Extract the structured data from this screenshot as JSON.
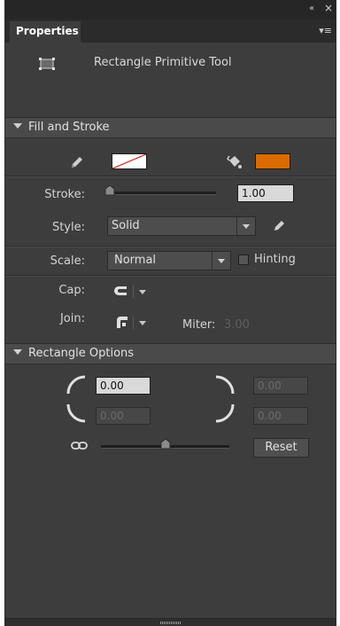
{
  "panel": {
    "collapse_icon": "«",
    "close_icon": "×",
    "menu_icon": "≡"
  },
  "tab": {
    "label": "Properties"
  },
  "tool": {
    "name": "Rectangle Primitive Tool",
    "icon": "rectangle-primitive-icon"
  },
  "fill_stroke": {
    "header": "Fill and Stroke",
    "stroke_color_icon": "pencil-icon",
    "fill_color_icon": "paint-bucket-icon",
    "fill_color": "#d96b00",
    "stroke_color": "none",
    "stroke_label": "Stroke:",
    "stroke_value": "1.00",
    "stroke_slider_level": 0,
    "style_label": "Style:",
    "style_value": "Solid",
    "edit_style_icon": "pencil-icon",
    "scale_label": "Scale:",
    "scale_value": "Normal",
    "hinting_label": "Hinting",
    "hinting_checked": false,
    "cap_label": "Cap:",
    "cap_icon": "cap-round-icon",
    "join_label": "Join:",
    "join_icon": "join-round-icon",
    "miter_label": "Miter:",
    "miter_value": "3.00"
  },
  "rect_options": {
    "header": "Rectangle Options",
    "top_left": "0.00",
    "top_right": "0.00",
    "bottom_left": "0.00",
    "bottom_right": "0.00",
    "lock_icon": "link-icon",
    "reset_label": "Reset",
    "corner_slider_level": 0.5
  },
  "colors": {
    "panel_bg": "#3d3d3d",
    "header_bg": "#4a4a4a",
    "accent_fill": "#d96b00",
    "stroke_none_line": "#d82020"
  }
}
